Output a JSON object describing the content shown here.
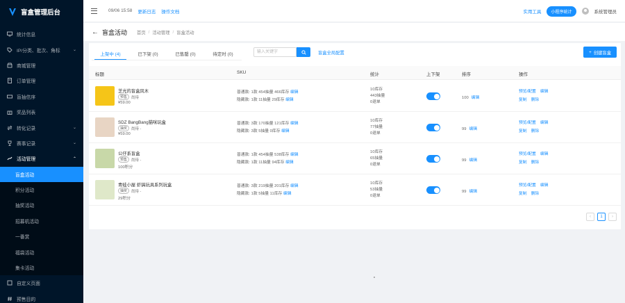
{
  "brand": {
    "title": "盲盒管理后台"
  },
  "sidebar": {
    "items": [
      {
        "label": "统计信息",
        "icon": "monitor-icon"
      },
      {
        "label": "IP/分类、批次、角标",
        "icon": "tag-icon",
        "arrow": "⌄"
      },
      {
        "label": "商城管理",
        "icon": "shop-icon"
      },
      {
        "label": "订单管理",
        "icon": "order-icon"
      },
      {
        "label": "盲抽信序",
        "icon": "ticket-icon"
      },
      {
        "label": "奖品列表",
        "icon": "gift-icon"
      },
      {
        "label": "转化记录",
        "icon": "swap-icon",
        "arrow": "⌄"
      },
      {
        "label": "赛事记录",
        "icon": "trophy-icon",
        "arrow": "⌄"
      },
      {
        "label": "活动管理",
        "icon": "activity-icon",
        "arrow": "⌃",
        "open": true
      }
    ],
    "sub_items": [
      {
        "label": "盲盒活动",
        "active": true
      },
      {
        "label": "积分活动"
      },
      {
        "label": "抽奖活动"
      },
      {
        "label": "招募机活动"
      },
      {
        "label": "一番赏"
      },
      {
        "label": "福袋活动"
      },
      {
        "label": "集卡活动"
      }
    ],
    "bottom_items": [
      {
        "label": "自定义页面",
        "icon": "page-icon"
      },
      {
        "label": "预售目的",
        "icon": "hash-icon"
      }
    ]
  },
  "header": {
    "time": "09/06 15:58",
    "links": [
      "更新日志",
      "操作文档"
    ],
    "right_link": "实用工具",
    "pill_button": "小程序统计",
    "user_name": "系统管理员"
  },
  "page": {
    "title": "盲盒活动",
    "breadcrumb": [
      "首页",
      "活动管理",
      "盲盒活动"
    ]
  },
  "tabs": [
    {
      "label": "上架中 (4)",
      "active": true
    },
    {
      "label": "已下架 (0)"
    },
    {
      "label": "已售罄 (0)"
    },
    {
      "label": "待定时 (0)"
    }
  ],
  "search": {
    "placeholder": "输入关键字",
    "global_config": "盲盒全局配置"
  },
  "create_button": "创建盲盒",
  "table": {
    "headers": [
      "标题",
      "SKU",
      "统计",
      "上下架",
      "排序",
      "操作"
    ],
    "rows": [
      {
        "name": "芝光的盲盒风木",
        "badge": "预售",
        "badge_note": "尚待",
        "price": "¥59.00",
        "sku": [
          {
            "text": "普通款: 1款  454抽量  466库存  ",
            "link": "编辑"
          },
          {
            "text": "隐藏款: 1款  11抽量  29库存  ",
            "link": "编辑"
          }
        ],
        "stats": [
          "10库存",
          "443抽量",
          "0退单"
        ],
        "sort": "100",
        "sort_link": "编辑",
        "ops": [
          [
            "预览/配置",
            "编辑"
          ],
          [
            "复制",
            "删除"
          ]
        ],
        "thumb_color": "#f5c518"
      },
      {
        "name": "SDZ BangBang猫咪玩盒",
        "badge": "抽奖",
        "badge_note": "尚待 -",
        "price": "¥59.00",
        "sku": [
          {
            "text": "普通款: 3款  170抽量  121库存  ",
            "link": "编辑"
          },
          {
            "text": "隐藏款: 3款  5抽量  0库存  ",
            "link": "编辑"
          }
        ],
        "stats": [
          "10库存",
          "77抽量",
          "0退单"
        ],
        "sort": "99",
        "sort_link": "编辑",
        "ops": [
          [
            "预览/配置",
            "编辑"
          ],
          [
            "复制",
            "删除"
          ]
        ],
        "thumb_color": "#e8d5c4"
      },
      {
        "name": "公仔系盲盒",
        "badge": "预售",
        "badge_note": "尚待 -",
        "price": "100积分",
        "sku": [
          {
            "text": "普通款: 1款  454抽量  538库存  ",
            "link": "编辑"
          },
          {
            "text": "隐藏款: 1款  11抽量  94库存  ",
            "link": "编辑"
          }
        ],
        "stats": [
          "10库存",
          "65抽量",
          "0退单"
        ],
        "sort": "99",
        "sort_link": "编辑",
        "ops": [
          [
            "预览/配置",
            "编辑"
          ],
          [
            "复制",
            "删除"
          ]
        ],
        "thumb_color": "#c8d8a8"
      },
      {
        "name": "青蛙小屋 虾搞玩具系列玩盒",
        "badge": "抽奖",
        "badge_note": "尚待 -",
        "price": "29积分",
        "sku": [
          {
            "text": "普通款: 3款  219抽量  201库存  ",
            "link": "编辑"
          },
          {
            "text": "隐藏款: 1款  5抽量  11库存  ",
            "link": "编辑"
          }
        ],
        "stats": [
          "10库存",
          "53抽量",
          "0退单"
        ],
        "sort": "99",
        "sort_link": "编辑",
        "ops": [
          [
            "预览/配置",
            "编辑"
          ],
          [
            "复制",
            "删除"
          ]
        ],
        "thumb_color": "#dfe8c9"
      }
    ]
  },
  "pagination": {
    "prev": "‹",
    "current": "1",
    "next": "›"
  }
}
